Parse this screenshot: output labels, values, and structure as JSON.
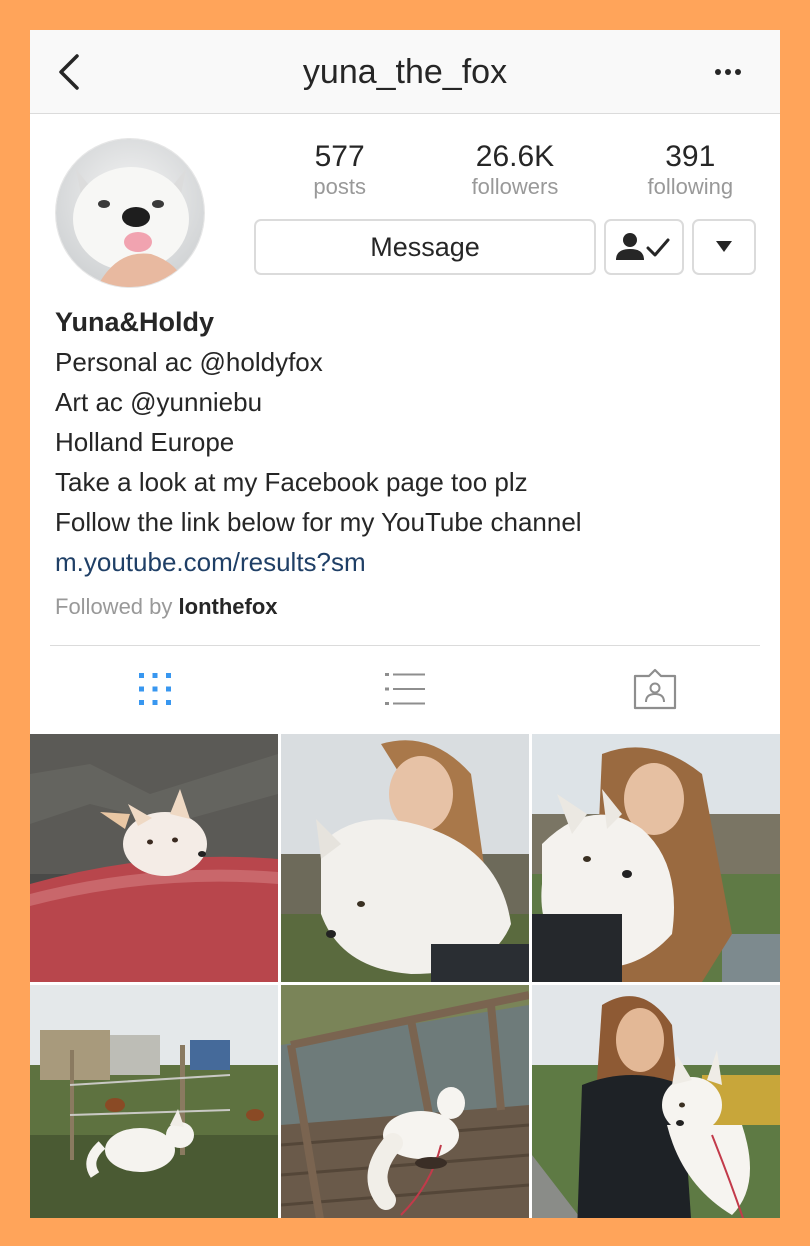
{
  "header": {
    "title": "yuna_the_fox",
    "back_icon": "chevron-left-icon",
    "more_icon": "ellipsis-icon"
  },
  "profile": {
    "stats": [
      {
        "value": "577",
        "label": "posts"
      },
      {
        "value": "26.6K",
        "label": "followers"
      },
      {
        "value": "391",
        "label": "following"
      }
    ],
    "message_label": "Message",
    "following_icon": "person-check-icon",
    "dropdown_icon": "triangle-down-icon"
  },
  "bio": {
    "name": "Yuna&Holdy",
    "lines": [
      "Personal ac @holdyfox",
      "Art ac @yunniebu",
      "Holland Europe",
      "Take a look at my Facebook page too plz",
      "Follow the link below for my YouTube channel"
    ],
    "link": "m.youtube.com/results?sm",
    "followed_by_prefix": "Followed by",
    "followed_by_user": "lonthefox"
  },
  "tabs": [
    {
      "icon": "grid-icon",
      "active": true
    },
    {
      "icon": "list-icon",
      "active": false
    },
    {
      "icon": "tagged-icon",
      "active": false
    }
  ],
  "colors": {
    "border_frame": "#ffa45a",
    "active_tab": "#3897f0",
    "link": "#1f3f66",
    "muted_text": "#999999"
  }
}
